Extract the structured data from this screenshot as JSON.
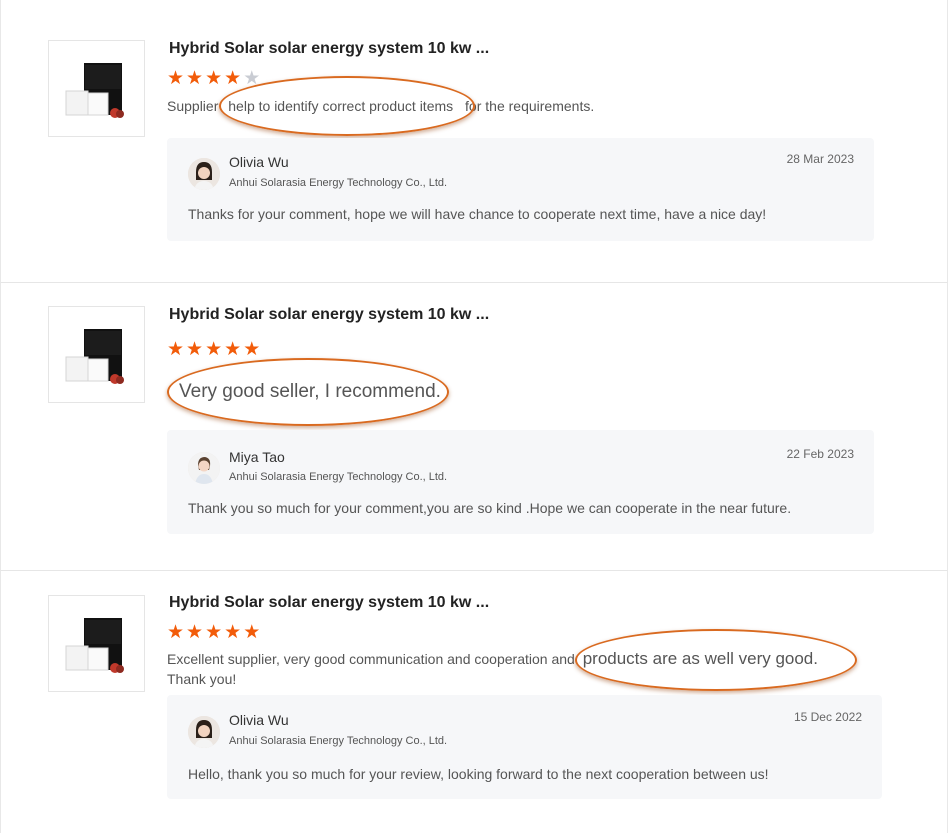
{
  "reviews": [
    {
      "product_title": "Hybrid Solar solar energy system 10 kw ...",
      "rating": 4,
      "comment_parts": [
        "Supplier ",
        "help to identify correct product items",
        " for the requirements."
      ],
      "reply": {
        "name": "Olivia Wu",
        "company": "Anhui Solarasia Energy Technology Co., Ltd.",
        "date": "28 Mar 2023",
        "text": "Thanks for your comment, hope we will have chance to cooperate next time, have a nice day!"
      }
    },
    {
      "product_title": "Hybrid Solar solar energy system 10 kw ...",
      "rating": 5,
      "comment_parts": [
        "Very good seller, I recommend."
      ],
      "reply": {
        "name": "Miya Tao",
        "company": "Anhui Solarasia Energy Technology Co., Ltd.",
        "date": "22 Feb 2023",
        "text": "Thank you so much for your comment,you are so kind .Hope we can cooperate in the near future."
      }
    },
    {
      "product_title": "Hybrid Solar solar energy system 10 kw ...",
      "rating": 5,
      "comment_parts": [
        "Excellent supplier, very good communication and cooperation and ",
        "products are as well very good.",
        "Thank you!"
      ],
      "reply": {
        "name": "Olivia Wu",
        "company": "Anhui Solarasia Energy Technology Co., Ltd.",
        "date": "15 Dec 2022",
        "text": "Hello, thank you so much for your review, looking forward to the next cooperation between us!"
      }
    }
  ],
  "colors": {
    "star_filled": "#f25c0a",
    "star_empty": "#c9ccd3",
    "highlight_ring": "#d96a20",
    "reply_bg": "#f6f7f9"
  },
  "icons": {
    "star": "★",
    "product_image": "solar-system-product-image",
    "avatar": "person-avatar-icon"
  }
}
